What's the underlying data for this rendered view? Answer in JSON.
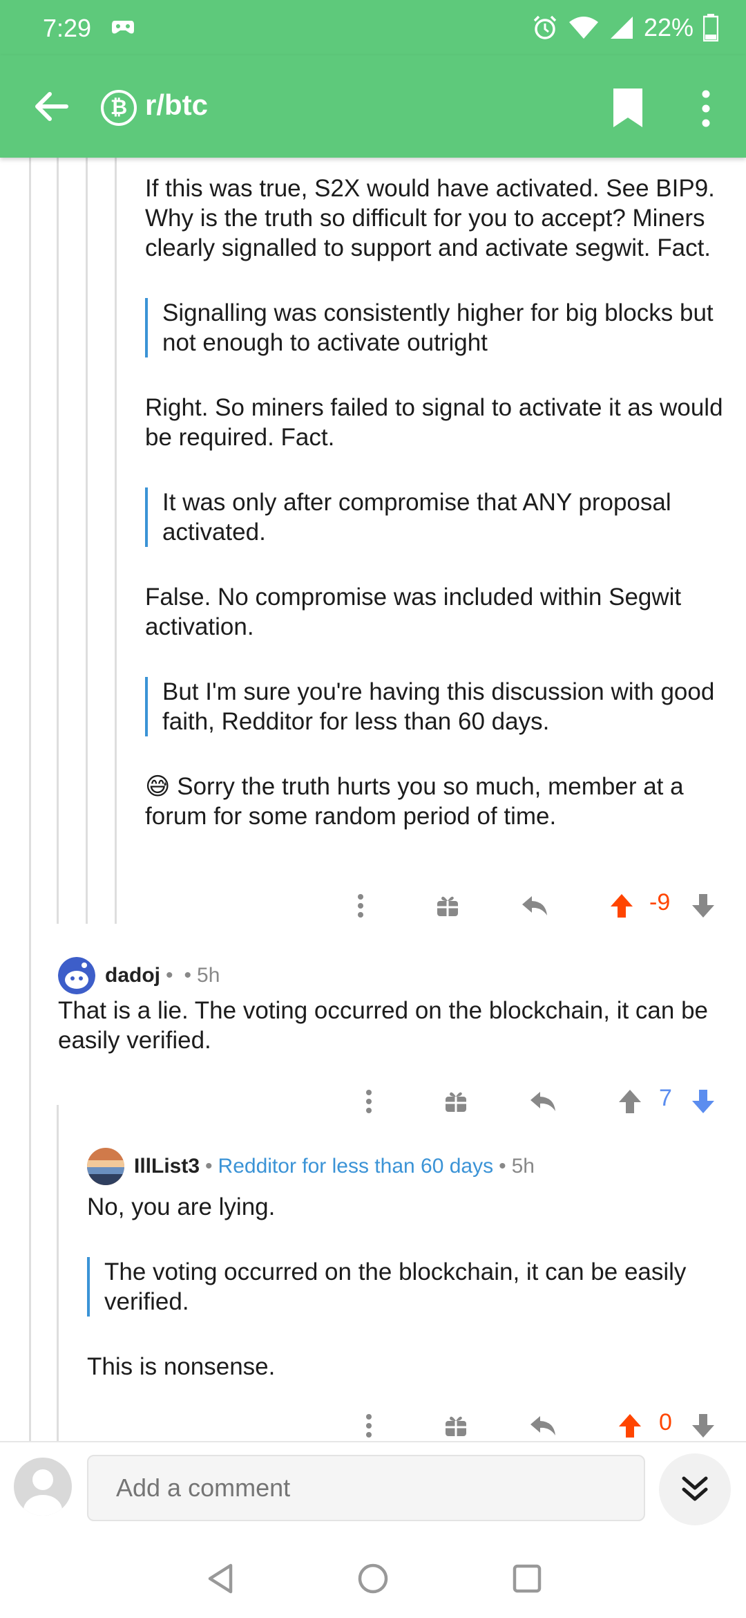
{
  "status_bar": {
    "time": "7:29",
    "battery_percent": "22%"
  },
  "app_bar": {
    "subreddit": "r/btc",
    "subreddit_icon_glyph": "₿"
  },
  "comment_top": {
    "paragraphs": [
      "If this was true, S2X would have activated.  See BIP9.  Why is the truth so difficult for you to accept? Miners clearly signalled to support and activate segwit. Fact."
    ],
    "quote1": "Signalling was consistently higher for big blocks but not enough to activate outright",
    "reply1": "Right.  So miners failed to signal to activate it as would be required.  Fact.",
    "quote2": "It was only after compromise that ANY proposal activated.",
    "reply2": "False.  No compromise was included within Segwit activation.",
    "quote3": "But I'm sure you're having this discussion with good faith, Redditor for less than 60 days.",
    "reply3_emoji": "😅",
    "reply3": "Sorry the truth hurts you so much, member at a forum for some random period of time.",
    "score": "-9",
    "score_color": "#ff4500",
    "vote_state": "upvoted"
  },
  "comment_dadoj": {
    "author": "dadoj",
    "separator": "•",
    "age": "5h",
    "body": "That is a lie. The voting occurred on the blockchain, it can be easily verified.",
    "score": "7",
    "score_color": "#5b8def",
    "vote_state": "downvoted"
  },
  "comment_illlist": {
    "author": "IllList3",
    "flair": "Redditor for less than 60 days",
    "age": "5h",
    "body1": "No, you are lying.",
    "quote": "The voting occurred on the blockchain, it can be easily verified.",
    "body2": "This is nonsense.",
    "score": "0",
    "score_color": "#ff4500",
    "vote_state": "upvoted"
  },
  "comment_bar": {
    "placeholder": "Add a comment"
  },
  "colors": {
    "accent_green": "#5ec97b",
    "quote_blue": "#3b93d6",
    "upvote_orange": "#ff4500",
    "downvote_blue": "#5b8def"
  }
}
